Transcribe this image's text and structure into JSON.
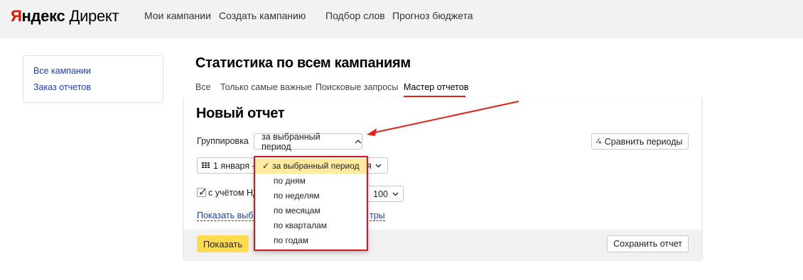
{
  "header": {
    "logo_y": "Я",
    "logo_rest": "ндекс",
    "logo_product": "Директ",
    "nav": [
      "Мои кампании",
      "Создать кампанию",
      "Подбор слов",
      "Прогноз бюджета"
    ]
  },
  "sidebar": {
    "items": [
      "Все кампании",
      "Заказ отчетов"
    ]
  },
  "main": {
    "title": "Статистика по всем кампаниям",
    "tabs": [
      "Все",
      "Только самые важные",
      "Поисковые запросы",
      "Мастер отчетов"
    ],
    "active_tab": "Мастер отчетов"
  },
  "report": {
    "title": "Новый отчет",
    "grouping_label": "Группировка",
    "grouping_value": "за выбранный период",
    "compare_label": "Сравнить периоды",
    "date_value": "1 января –",
    "date_tail": "я",
    "vat_label": "с учётом НД",
    "count_value": "100",
    "show_link_left": "Показать выбр",
    "show_link_right": "тры",
    "show_button": "Показать",
    "save_button": "Сохранить отчет"
  },
  "dropdown": {
    "check": "✓",
    "options": [
      "за выбранный период",
      "по дням",
      "по неделям",
      "по месяцам",
      "по кварталам",
      "по годам"
    ],
    "selected_index": 0
  },
  "colors": {
    "accent_red": "#d7141a",
    "link_blue": "#1a3dc1",
    "button_yellow": "#ffdb4d",
    "selection_yellow": "#ffeba0"
  }
}
